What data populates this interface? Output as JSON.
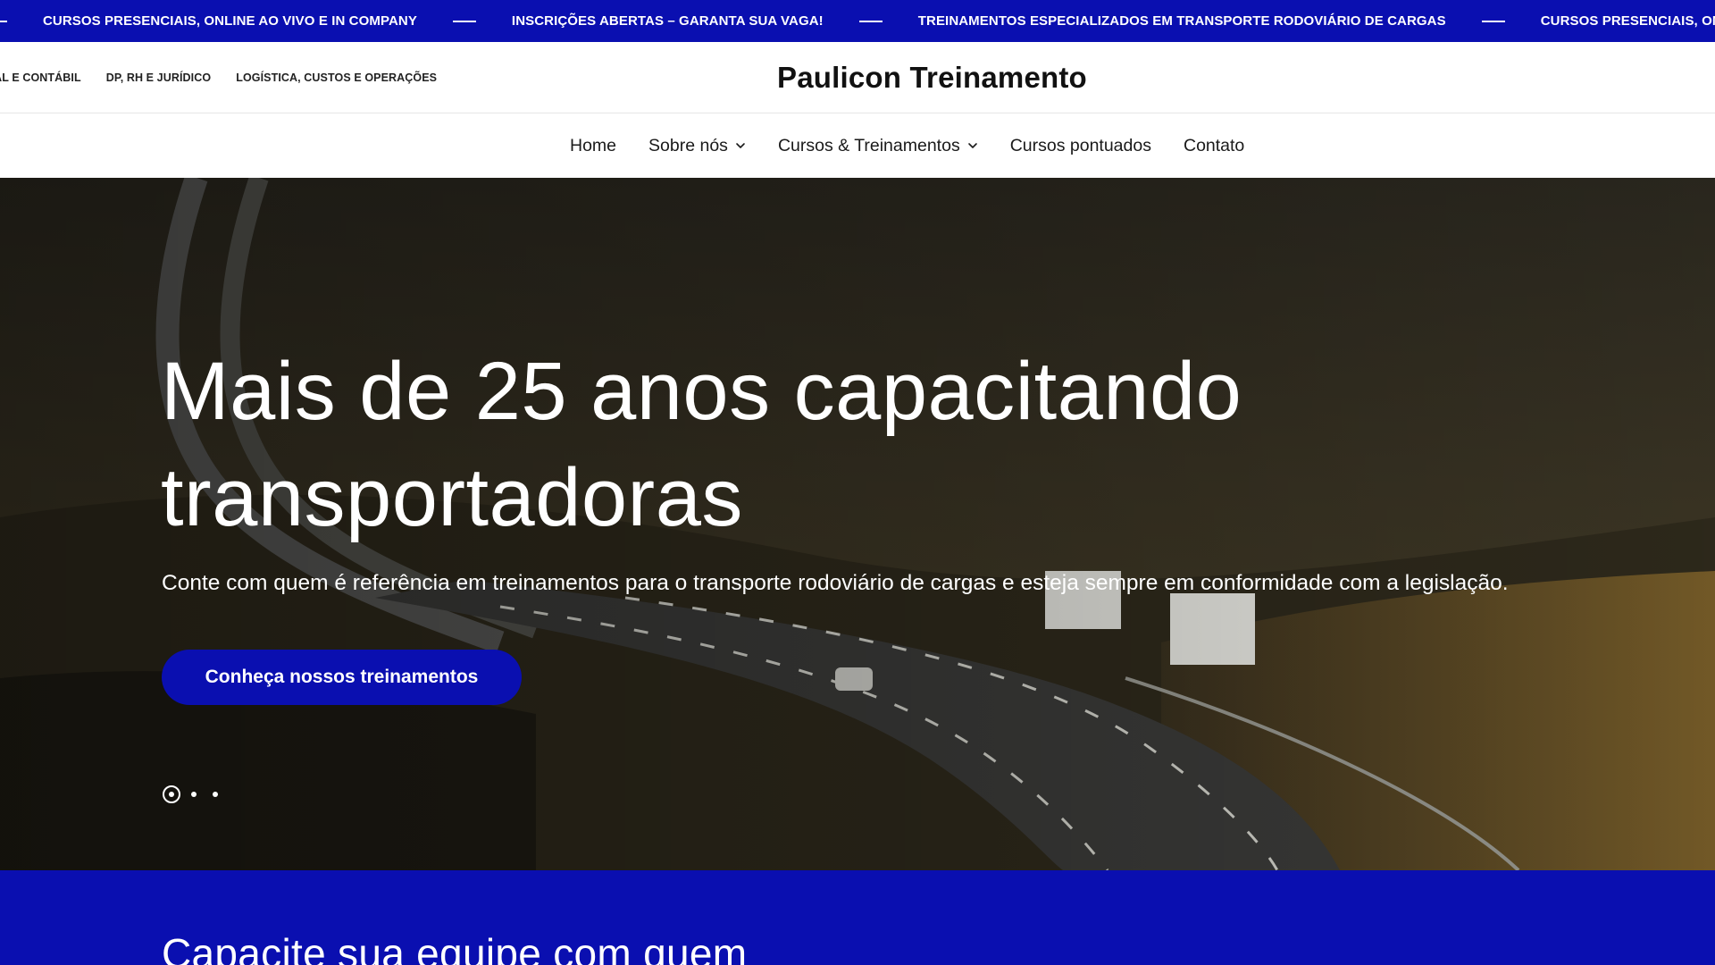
{
  "announcement": {
    "items": [
      "CURSOS PRESENCIAIS, ONLINE AO VIVO E IN COMPANY",
      "INSCRIÇÕES ABERTAS – GARANTA SUA VAGA!",
      "TREINAMENTOS ESPECIALIZADOS EM TRANSPORTE RODOVIÁRIO DE CARGAS",
      "CURSOS PRESENCIAIS, ON"
    ]
  },
  "header": {
    "category_links": [
      "CAL E CONTÁBIL",
      "DP, RH E JURÍDICO",
      "LOGÍSTICA, CUSTOS E OPERAÇÕES"
    ],
    "brand": "Paulicon Treinamento"
  },
  "nav": {
    "home": "Home",
    "sobre": "Sobre nós",
    "cursos": "Cursos & Treinamentos",
    "pontuados": "Cursos pontuados",
    "contato": "Contato"
  },
  "hero": {
    "title": "Mais de 25 anos capacitando transportadoras",
    "subtitle": "Conte com quem é referência em treinamentos para o transporte rodoviário de cargas e esteja sempre em conformidade com a legislação.",
    "cta_label": "Conheça nossos treinamentos",
    "slides_total": 3,
    "slide_active": 1
  },
  "section": {
    "heading": "Capacite sua equipe com quem"
  },
  "colors": {
    "brand_blue": "#0a0fb0",
    "white": "#ffffff"
  },
  "icons": {
    "dropdown": "chevron-down-icon",
    "slide_indicator": "dot-icon"
  }
}
